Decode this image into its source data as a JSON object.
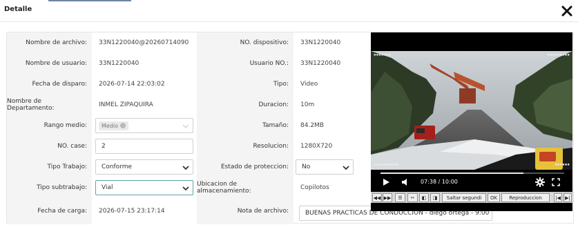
{
  "window": {
    "title": "Detalle",
    "close_icon": "close-icon"
  },
  "fields": {
    "nombre_archivo": {
      "label": "Nombre de archivo:",
      "value": "33N1220040@20260714090"
    },
    "no_dispositivo": {
      "label": "NO. dispositivo:",
      "value": "33N1220040"
    },
    "nombre_usuario": {
      "label": "Nombre de usuario:",
      "value": "33N1220040"
    },
    "usuario_no": {
      "label": "Usuario NO.:",
      "value": "33N1220040"
    },
    "fecha_disparo": {
      "label": "Fecha de disparo:",
      "value": "2026-07-14 22:03:02"
    },
    "tipo": {
      "label": "Tipo:",
      "value": "Video"
    },
    "departamento": {
      "label": "Nombre de Departamento:",
      "value": "INMEL ZIPAQUIRA"
    },
    "duracion": {
      "label": "Duracion:",
      "value": "10m"
    },
    "rango_medio": {
      "label": "Rango medio:",
      "value": "Medio"
    },
    "tamano": {
      "label": "Tamaño:",
      "value": "84.2MB"
    },
    "no_case": {
      "label": "NO. case:",
      "value": "2"
    },
    "resolucion": {
      "label": "Resolucion:",
      "value": "1280X720"
    },
    "tipo_trabajo": {
      "label": "Tipo Trabajo:",
      "value": "Conforme"
    },
    "estado_proteccion": {
      "label": "Estado de proteccion:",
      "value": "No"
    },
    "tipo_subtrabajo": {
      "label": "Tipo subtrabajo:",
      "value": "Vial"
    },
    "ubicacion": {
      "label": "Ubicacion de almacenamiento:",
      "value": "Copilotos"
    },
    "fecha_carga": {
      "label": "Fecha de carga:",
      "value": "2026-07-15 23:17:14"
    },
    "nota_archivo": {
      "label": "Nota de archivo:",
      "value": "BUENAS PRACTICAS DE CONDUCCIÓN - diego ortega - 9:00"
    }
  },
  "player": {
    "time": "07:38 / 10:00",
    "progress": 0.78,
    "play_icon": "play-icon",
    "volume_icon": "volume-icon",
    "settings_icon": "gear-icon",
    "fullscreen_icon": "fullscreen-icon"
  },
  "player_toolbar": {
    "saltar_label": "Saltar segundi",
    "ok_label": "OK",
    "reproduccion_label": "Reproduccion"
  }
}
